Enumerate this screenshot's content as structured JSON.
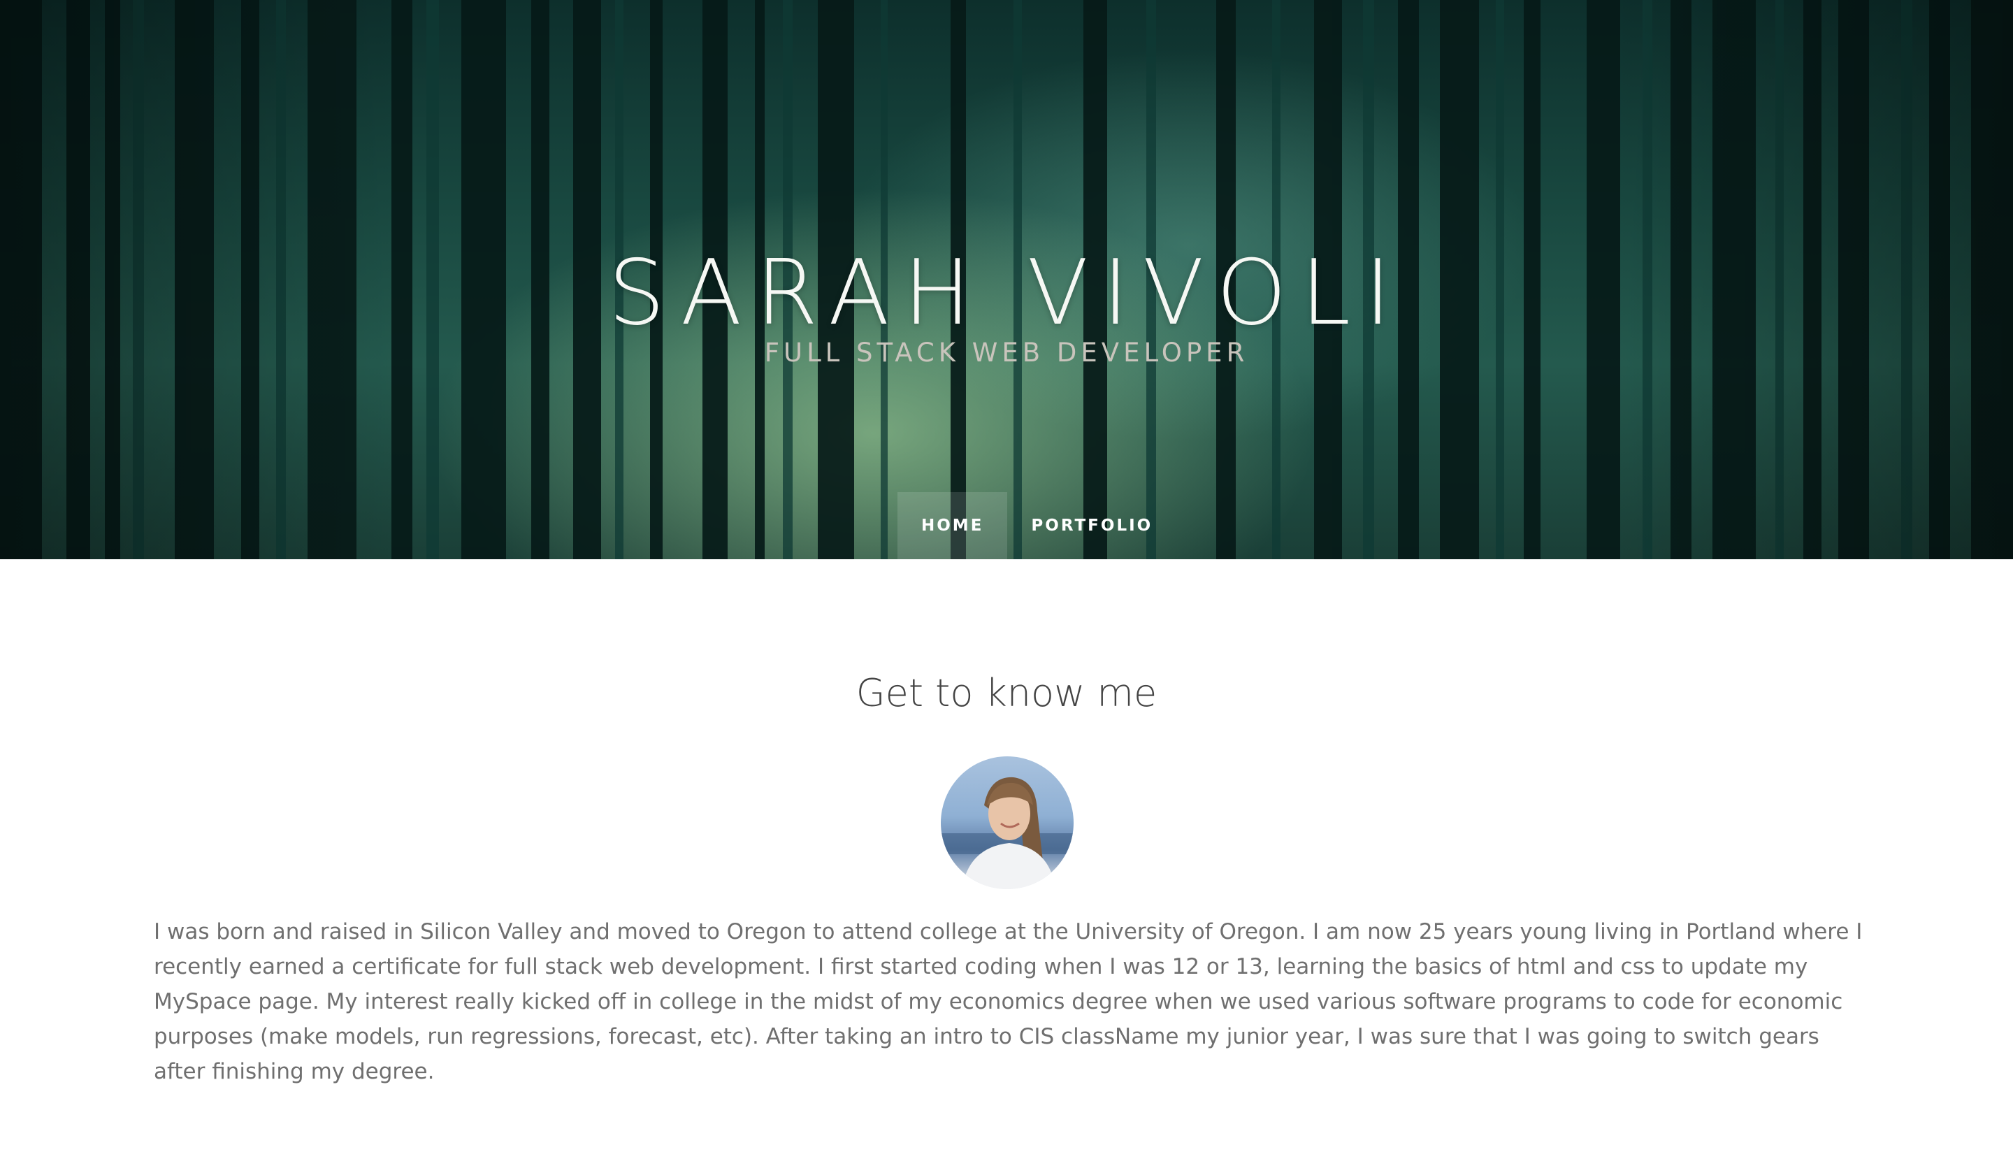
{
  "hero": {
    "title": "SARAH VIVOLI",
    "subtitle": "FULL STACK WEB DEVELOPER",
    "background": "forest-photo"
  },
  "nav": {
    "items": [
      {
        "label": "HOME",
        "active": true
      },
      {
        "label": "PORTFOLIO",
        "active": false
      }
    ]
  },
  "about": {
    "heading": "Get to know me",
    "avatar": "profile-photo",
    "text": "I was born and raised in Silicon Valley and moved to Oregon to attend college at the University of Oregon. I am now 25 years young living in Portland where I recently earned a certificate for full stack web development. I first started coding when I was 12 or 13, learning the basics of html and css to update my MySpace page. My interest really kicked off in college in the midst of my economics degree when we used various software programs to code for economic purposes (make models, run regressions, forecast, etc). After taking an intro to CIS className my junior year, I was sure that I was going to switch gears after finishing my degree."
  },
  "colors": {
    "hero_dark": "#0d2f2c",
    "hero_light": "#bfe9a8",
    "heading": "#444444",
    "body_text": "#6f6f6f"
  }
}
